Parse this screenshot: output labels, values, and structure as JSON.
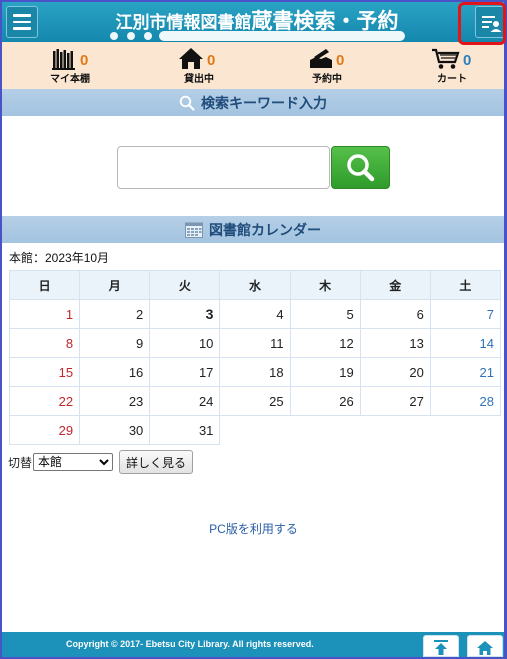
{
  "header": {
    "title_part1": "江別市情報図書館",
    "title_part2": "蔵書検索・予約"
  },
  "status": [
    {
      "label": "マイ本棚",
      "count": "0",
      "icon": "bookshelf-icon"
    },
    {
      "label": "貸出中",
      "count": "0",
      "icon": "house-icon"
    },
    {
      "label": "予約中",
      "count": "0",
      "icon": "reserve-icon"
    },
    {
      "label": "カート",
      "count": "0",
      "icon": "cart-icon"
    }
  ],
  "search": {
    "heading": "検索キーワード入力",
    "value": ""
  },
  "calendar": {
    "heading": "図書館カレンダー",
    "caption": "本館：2023年10月",
    "weekdays": [
      "日",
      "月",
      "火",
      "水",
      "木",
      "金",
      "土"
    ],
    "weeks": [
      [
        "1",
        "2",
        "3",
        "4",
        "5",
        "6",
        "7"
      ],
      [
        "8",
        "9",
        "10",
        "11",
        "12",
        "13",
        "14"
      ],
      [
        "15",
        "16",
        "17",
        "18",
        "19",
        "20",
        "21"
      ],
      [
        "22",
        "23",
        "24",
        "25",
        "26",
        "27",
        "28"
      ],
      [
        "29",
        "30",
        "31",
        "",
        "",
        "",
        ""
      ]
    ],
    "switch_label": "切替",
    "switch_selected": "本館",
    "detail_button": "詳しく見る"
  },
  "pc_link": "PC版を利用する",
  "footer": {
    "copyright": "Copyright © 2017- Ebetsu City Library. All rights reserved."
  },
  "colors": {
    "header": "#1c91b9",
    "status_bg": "#fbe6d2",
    "count_orange": "#e07a17",
    "count_blue": "#2e7fbd",
    "sunday": "#c0262c",
    "saturday": "#2e72b8",
    "highlight": "#e3141a"
  }
}
